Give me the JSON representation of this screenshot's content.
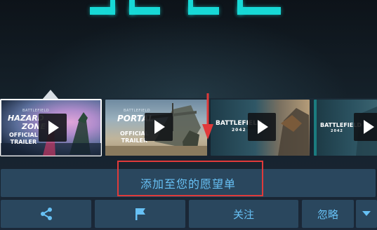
{
  "store_page": {
    "wishlist_button": {
      "label": "添加至您的愿望单"
    },
    "actions": {
      "share": {
        "icon": "share-icon"
      },
      "flag": {
        "icon": "flag-icon"
      },
      "follow": {
        "label": "关注"
      },
      "ignore": {
        "label": "忽略"
      },
      "more": {
        "icon": "chevron-down-icon"
      }
    },
    "thumbnails": [
      {
        "brand": "BATTLEFIELD",
        "title_line1": "HAZARD",
        "title_line2": "ZONE",
        "tag_line1": "OFFICIAL",
        "tag_line2": "TRAILER",
        "selected": true
      },
      {
        "brand": "BATTLEFIELD",
        "title_line1": "PORTAL",
        "tag_line1": "OFFICIAL",
        "tag_line2": "TRAILER",
        "selected": false
      },
      {
        "title_line1": "BATTLEFIELD",
        "title_line2": "2042",
        "selected": false
      },
      {
        "title_line1": "BATTLEFIELD",
        "title_line2": "2042",
        "selected": false
      }
    ]
  },
  "colors": {
    "button_bg": "#2a475e",
    "link_blue": "#67c1f5",
    "logo_cyan": "#17d9d6",
    "annotation_red": "#e03a3a"
  }
}
